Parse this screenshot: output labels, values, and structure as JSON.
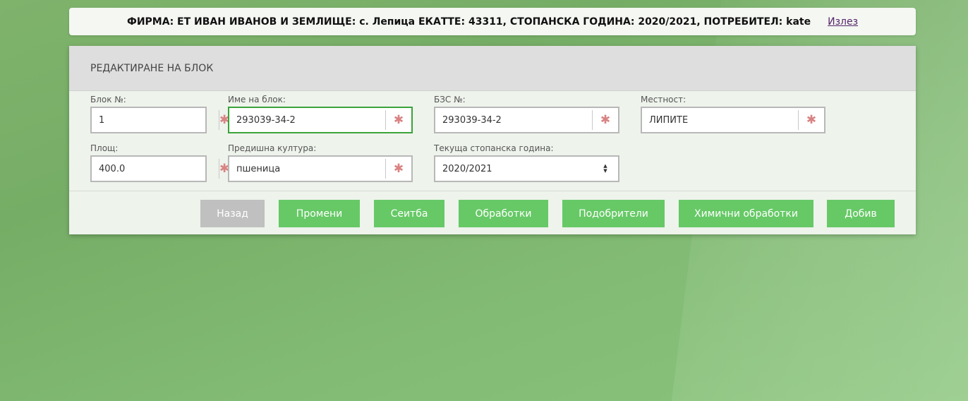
{
  "topbar": {
    "info": "ФИРМА: ЕТ ИВАН ИВАНОВ И ЗЕМЛИЩЕ: с. Лепица ЕКАТТЕ: 43311, СТОПАНСКА ГОДИНА: 2020/2021, ПОТРЕБИТЕЛ: kate",
    "logout": "Излез"
  },
  "panel": {
    "title": "РЕДАКТИРАНЕ НА БЛОК"
  },
  "form": {
    "block_no": {
      "label": "Блок №:",
      "value": "1"
    },
    "block_name": {
      "label": "Име на блок:",
      "value": "293039-34-2"
    },
    "bzs_no": {
      "label": "БЗС №:",
      "value": "293039-34-2"
    },
    "locality": {
      "label": "Местност:",
      "value": "ЛИПИТЕ"
    },
    "area": {
      "label": "Площ:",
      "value": "400.0"
    },
    "prev_crop": {
      "label": "Предишна култура:",
      "value": "пшеница"
    },
    "current_year": {
      "label": "Текуща стопанска година:",
      "value": "2020/2021"
    },
    "required_mark": "✱"
  },
  "buttons": {
    "back": "Назад",
    "change": "Промени",
    "sowing": "Сеитба",
    "treatments": "Обработки",
    "fertilizers": "Подобрители",
    "chemical": "Химични обработки",
    "yield": "Добив"
  },
  "colors": {
    "accent_green": "#66c966",
    "focus_green": "#3aa33a",
    "required_red": "#d98383",
    "back_grey": "#c0c0c0"
  }
}
